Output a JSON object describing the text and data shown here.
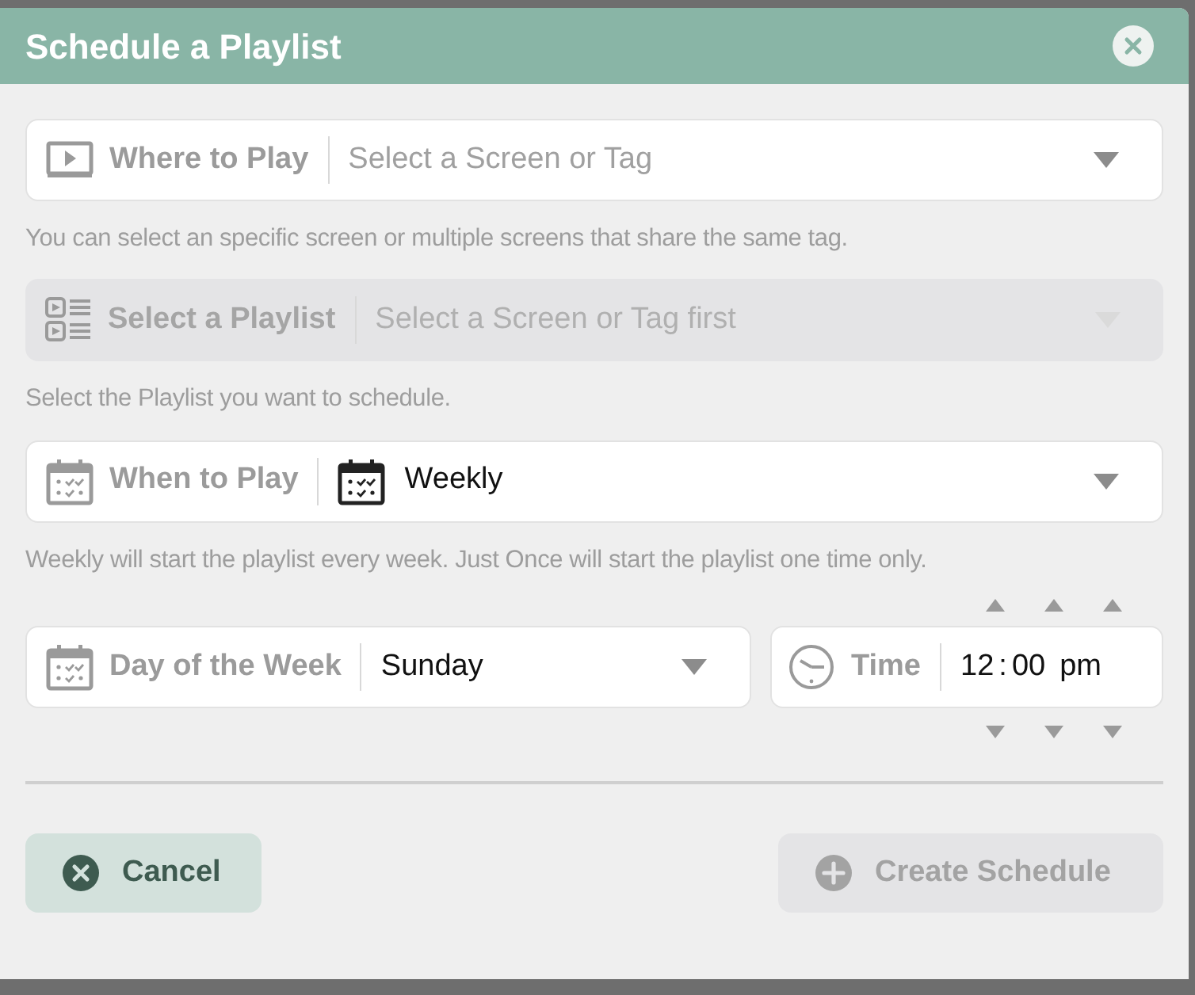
{
  "dialog": {
    "title": "Schedule a Playlist"
  },
  "fields": [
    {
      "kind": "screen",
      "label": "Where to Play",
      "placeholder": "Select a Screen or Tag",
      "disabled": false,
      "help": "You can select an specific screen or multiple screens that share the same tag."
    },
    {
      "kind": "playlist",
      "label": "Select a Playlist",
      "placeholder": "Select a Screen or Tag first",
      "disabled": true,
      "help": "Select the Playlist you want to schedule."
    },
    {
      "kind": "calendar",
      "label": "When to Play",
      "value": "Weekly",
      "disabled": false,
      "help": "Weekly will start the playlist every week. Just Once will start the playlist one time only."
    }
  ],
  "day": {
    "label": "Day of the Week",
    "value": "Sunday"
  },
  "time": {
    "label": "Time",
    "hour": "12",
    "separator": ":",
    "minute": "00",
    "period": "pm"
  },
  "buttons": [
    {
      "kind": "cancel",
      "label": "Cancel",
      "disabled": false
    },
    {
      "kind": "create",
      "label": "Create Schedule",
      "disabled": true
    }
  ]
}
